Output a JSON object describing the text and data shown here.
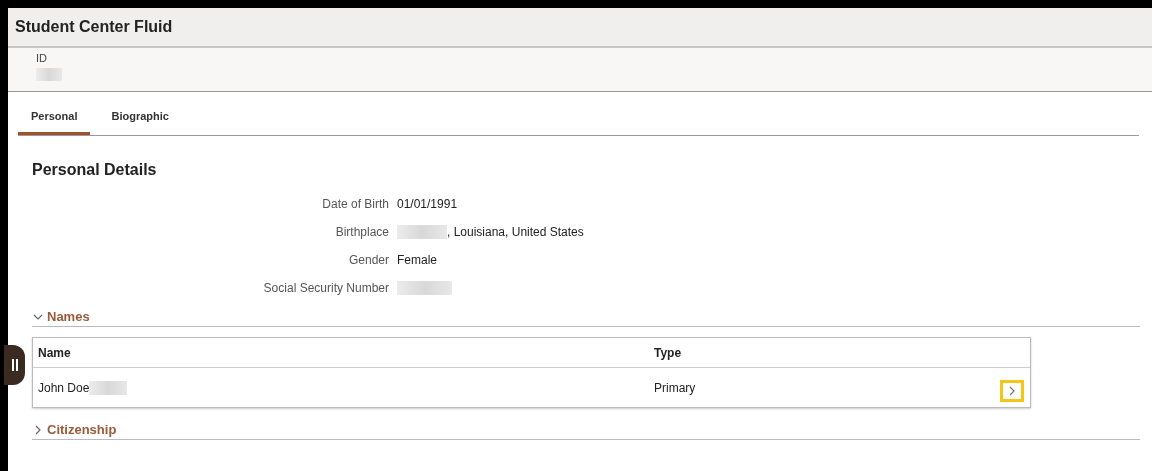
{
  "header": {
    "title": "Student Center Fluid"
  },
  "id_band": {
    "label": "ID"
  },
  "tabs": [
    {
      "label": "Personal",
      "selected": true
    },
    {
      "label": "Biographic",
      "selected": false
    }
  ],
  "section": {
    "title": "Personal Details"
  },
  "details": [
    {
      "label": "Date of Birth",
      "value": "01/01/1991",
      "redacted": false
    },
    {
      "label": "Birthplace",
      "value": ", Louisiana, United States",
      "redacted": true
    },
    {
      "label": "Gender",
      "value": "Female",
      "redacted": false
    },
    {
      "label": "Social Security Number",
      "redacted": true
    }
  ],
  "groups": [
    {
      "title": "Names",
      "expanded": true,
      "table": {
        "columns": [
          "Name",
          "Type"
        ],
        "rows": [
          {
            "cells": [
              "John Doe",
              "Primary"
            ],
            "highlighted": true
          }
        ]
      }
    },
    {
      "title": "Citizenship",
      "expanded": false
    }
  ]
}
